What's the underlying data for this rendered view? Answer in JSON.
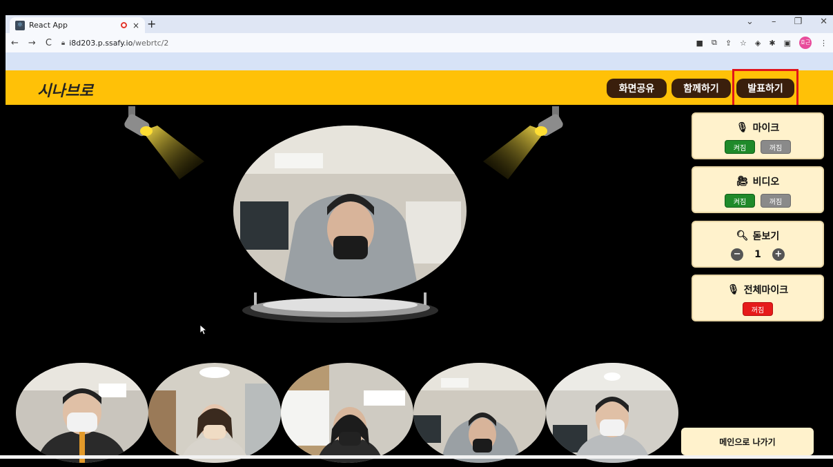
{
  "browser": {
    "tab_title": "React App",
    "tab_close": "×",
    "new_tab": "+",
    "url_host": "i8d203.p.ssafy.io",
    "url_path": "/webrtc/2",
    "profile_label": "호근",
    "win_min": "–",
    "win_restore": "❐",
    "win_close": "✕",
    "win_menu": "⌄"
  },
  "app": {
    "logo": "시나브로",
    "header_buttons": [
      "화면공유",
      "함께하기",
      "발표하기"
    ]
  },
  "controls": {
    "mic": {
      "title": "마이크",
      "on": "켜짐",
      "off": "꺼짐"
    },
    "video": {
      "title": "비디오",
      "on": "켜짐",
      "off": "꺼짐"
    },
    "zoom": {
      "title": "돋보기",
      "minus": "−",
      "value": "1",
      "plus": "+"
    },
    "all_mic": {
      "title": "전체마이크",
      "state": "꺼짐"
    }
  },
  "exit_label": "메인으로 나가기",
  "colors": {
    "header": "#ffc107",
    "header_button": "#3a1f0c",
    "panel": "#fff2cc",
    "on": "#1f8a2a",
    "off": "#8a8a8a",
    "danger": "#e61b1b",
    "highlight_box": "#e0141b"
  }
}
